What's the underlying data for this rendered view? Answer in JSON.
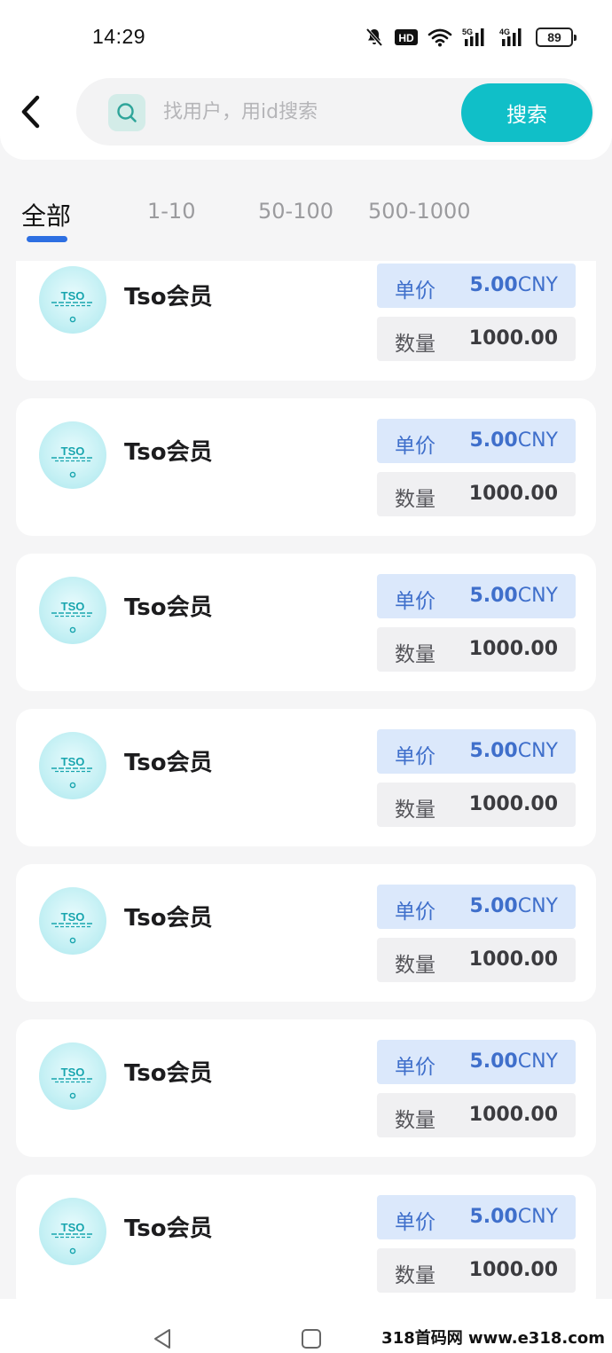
{
  "status_bar": {
    "time": "14:29",
    "icons": [
      "mute-bell-icon",
      "hd-icon",
      "wifi-icon",
      "signal-5g-icon",
      "signal-4g-icon"
    ],
    "signal_5g_label": "5G",
    "signal_4g_label": "4G",
    "hd_label": "HD",
    "battery": "89"
  },
  "header": {
    "back_icon": "chevron-left-icon",
    "search_placeholder": "找用户，用id搜索",
    "search_button_label": "搜索",
    "search_accent": "#10bfc8"
  },
  "tabs": {
    "items": [
      {
        "label": "全部",
        "active": true
      },
      {
        "label": "1-10",
        "active": false
      },
      {
        "label": "50-100",
        "active": false
      },
      {
        "label": "500-1000",
        "active": false
      }
    ],
    "indicator_color": "#2d6fe2"
  },
  "list": {
    "items": [
      {
        "name": "Tso会员",
        "logo_text": "TSO",
        "price_label": "单价",
        "price_value": "5.00",
        "price_unit": "CNY",
        "qty_label": "数量",
        "qty_value": "1000.00"
      },
      {
        "name": "Tso会员",
        "logo_text": "TSO",
        "price_label": "单价",
        "price_value": "5.00",
        "price_unit": "CNY",
        "qty_label": "数量",
        "qty_value": "1000.00"
      },
      {
        "name": "Tso会员",
        "logo_text": "TSO",
        "price_label": "单价",
        "price_value": "5.00",
        "price_unit": "CNY",
        "qty_label": "数量",
        "qty_value": "1000.00"
      },
      {
        "name": "Tso会员",
        "logo_text": "TSO",
        "price_label": "单价",
        "price_value": "5.00",
        "price_unit": "CNY",
        "qty_label": "数量",
        "qty_value": "1000.00"
      },
      {
        "name": "Tso会员",
        "logo_text": "TSO",
        "price_label": "单价",
        "price_value": "5.00",
        "price_unit": "CNY",
        "qty_label": "数量",
        "qty_value": "1000.00"
      },
      {
        "name": "Tso会员",
        "logo_text": "TSO",
        "price_label": "单价",
        "price_value": "5.00",
        "price_unit": "CNY",
        "qty_label": "数量",
        "qty_value": "1000.00"
      },
      {
        "name": "Tso会员",
        "logo_text": "TSO",
        "price_label": "单价",
        "price_value": "5.00",
        "price_unit": "CNY",
        "qty_label": "数量",
        "qty_value": "1000.00"
      }
    ]
  },
  "nav_bar": {
    "icons": [
      "triangle-back-icon",
      "square-home-icon"
    ],
    "watermark": "318首码网 www.e318.com"
  }
}
